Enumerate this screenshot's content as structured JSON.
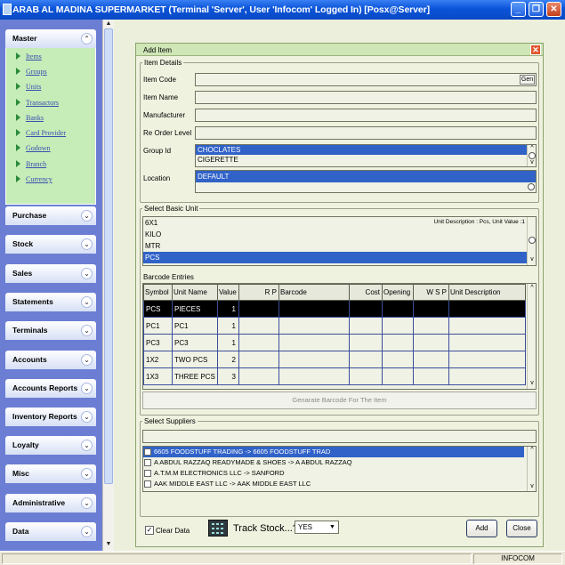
{
  "window": {
    "title": "ARAB AL MADINA SUPERMARKET (Terminal 'Server', User 'Infocom' Logged In) [Posx@Server]",
    "min_glyph": "_",
    "max_glyph": "❐",
    "close_glyph": "✕"
  },
  "nav": {
    "master": {
      "label": "Master",
      "items": [
        "Items",
        "Groups",
        "Units",
        "Transactors",
        "Banks",
        "Card Provider",
        "Godown",
        "Branch",
        "Currency"
      ]
    },
    "groups": [
      "Purchase",
      "Stock",
      "Sales",
      "Statements",
      "Terminals",
      "Accounts",
      "Accounts Reports",
      "Inventory Reports",
      "Loyalty",
      "Misc",
      "Administrative",
      "Data"
    ],
    "expanded_chevron": "⌃",
    "collapsed_chevron": "⌄"
  },
  "dialog": {
    "title": "Add Item",
    "item_details": {
      "legend": "Item Details",
      "item_code_label": "Item Code",
      "gen_label": "Gen",
      "item_name_label": "Item Name",
      "manufacturer_label": "Manufacturer",
      "reorder_label": "Re Order Level",
      "group_id_label": "Group Id",
      "groups": [
        "CHOCLATES",
        "CIGERETTE"
      ],
      "location_label": "Location",
      "locations": [
        "DEFAULT"
      ]
    },
    "basic_unit": {
      "legend": "Select Basic  Unit",
      "units": [
        "6X1",
        "KILO",
        "MTR",
        "PCS"
      ],
      "unit_description": "Unit Description : Pcs, Unit Value :1"
    },
    "barcode": {
      "label": "Barcode Entries",
      "columns": [
        "Symbol",
        "Unit Name",
        "Value",
        "R  P",
        "Barcode",
        "Cost",
        "Opening",
        "W S P",
        "Unit Description"
      ],
      "rows": [
        {
          "symbol": "PCS",
          "unit_name": "PIECES",
          "value": "1"
        },
        {
          "symbol": "PC1",
          "unit_name": "PC1",
          "value": "1"
        },
        {
          "symbol": "PC3",
          "unit_name": "PC3",
          "value": "1"
        },
        {
          "symbol": "1X2",
          "unit_name": "TWO PCS",
          "value": "2"
        },
        {
          "symbol": "1X3",
          "unit_name": "THREE PCS",
          "value": "3"
        }
      ],
      "generate_button": "Genarate Barcode For The Item"
    },
    "suppliers": {
      "legend": "Select Suppliers",
      "rows": [
        "6605 FOODSTUFF TRADING -> 6605 FOODSTUFF  TRAD",
        "A ABDUL RAZZAQ READYMADE & SHOES -> A ABDUL RAZZAQ",
        "A.T.M.M ELECTRONICS LLC -> SANFORD",
        "AAK MIDDLE EAST LLC -> AAK MIDDLE EAST LLC"
      ]
    },
    "footer": {
      "clear_data_label": "Clear Data",
      "track_stock_label": "Track Stock...?",
      "track_stock_value": "YES",
      "add_label": "Add",
      "close_label": "Close"
    }
  },
  "status": {
    "user": "INFOCOM"
  }
}
